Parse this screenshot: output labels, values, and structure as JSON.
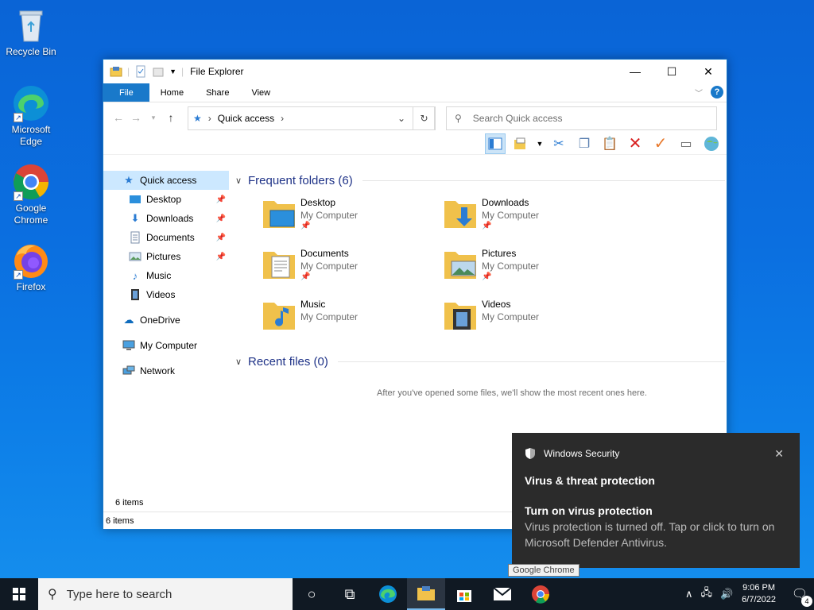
{
  "desktop": {
    "icons": [
      {
        "label": "Recycle Bin",
        "icon": "recycle-bin-icon"
      },
      {
        "label": "Microsoft Edge",
        "icon": "edge-icon"
      },
      {
        "label": "Google Chrome",
        "icon": "chrome-icon"
      },
      {
        "label": "Firefox",
        "icon": "firefox-icon"
      }
    ]
  },
  "explorer": {
    "title": "File Explorer",
    "tabs": {
      "file": "File",
      "home": "Home",
      "share": "Share",
      "view": "View"
    },
    "address": {
      "location": "Quick access"
    },
    "search_placeholder": "Search Quick access",
    "nav": {
      "quick_access": "Quick access",
      "desktop": "Desktop",
      "downloads": "Downloads",
      "documents": "Documents",
      "pictures": "Pictures",
      "music": "Music",
      "videos": "Videos",
      "onedrive": "OneDrive",
      "my_computer": "My Computer",
      "network": "Network"
    },
    "frequent_header": "Frequent folders (6)",
    "folders": [
      {
        "name": "Desktop",
        "location": "My Computer"
      },
      {
        "name": "Downloads",
        "location": "My Computer"
      },
      {
        "name": "Documents",
        "location": "My Computer"
      },
      {
        "name": "Pictures",
        "location": "My Computer"
      },
      {
        "name": "Music",
        "location": "My Computer"
      },
      {
        "name": "Videos",
        "location": "My Computer"
      }
    ],
    "recent_header": "Recent files (0)",
    "recent_message": "After you've opened some files, we'll show the most recent ones here.",
    "item_count": "6 items",
    "status": "6 items"
  },
  "toast": {
    "app": "Windows Security",
    "title": "Virus & threat protection",
    "heading": "Turn on virus protection",
    "body": "Virus protection is turned off. Tap or click to turn on Microsoft Defender Antivirus."
  },
  "tooltip": "Google Chrome",
  "taskbar": {
    "search_placeholder": "Type here to search",
    "time": "9:06 PM",
    "date": "6/7/2022",
    "notification_count": "4"
  },
  "colors": {
    "accent": "#1979ca",
    "taskbar": "#101923",
    "toast": "#2b2b2b"
  }
}
